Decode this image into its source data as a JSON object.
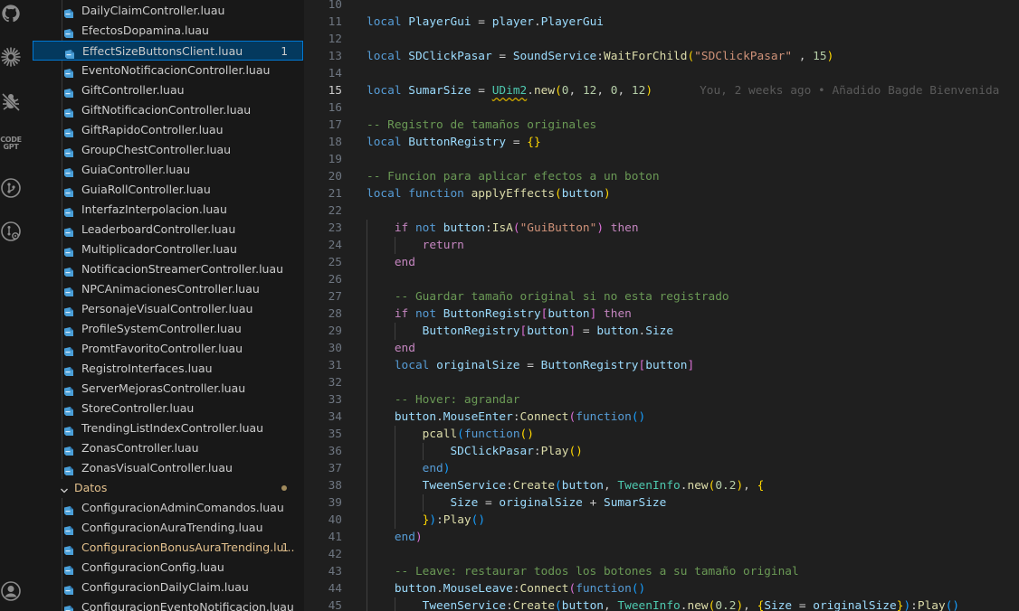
{
  "colors": {
    "modified": "#e2c08d",
    "selection": "#04395e",
    "focus_border": "#0078d4",
    "file_icon": "#4a9fd8"
  },
  "activity_bar": {
    "icons": [
      {
        "name": "github-icon"
      },
      {
        "name": "gear-flower-icon"
      },
      {
        "name": "no-bug-icon"
      },
      {
        "name": "codegpt-icon",
        "text": "CODE GPT"
      },
      {
        "name": "git-graph-icon"
      },
      {
        "name": "gitlens-icon"
      },
      {
        "name": "account-icon"
      }
    ]
  },
  "explorer": {
    "files_top": [
      {
        "label": "DailyClaimController.luau"
      },
      {
        "label": "EfectosDopamina.luau"
      },
      {
        "label": "EffectSizeButtonsClient.luau",
        "badge": "1",
        "selected": true
      },
      {
        "label": "EventoNotificacionController.luau"
      },
      {
        "label": "GiftController.luau"
      },
      {
        "label": "GiftNotificacionController.luau"
      },
      {
        "label": "GiftRapidoController.luau"
      },
      {
        "label": "GroupChestController.luau"
      },
      {
        "label": "GuiaController.luau"
      },
      {
        "label": "GuiaRollController.luau"
      },
      {
        "label": "InterfazInterpolacion.luau"
      },
      {
        "label": "LeaderboardController.luau"
      },
      {
        "label": "MultiplicadorController.luau"
      },
      {
        "label": "NotificacionStreamerController.luau"
      },
      {
        "label": "NPCAnimacionesController.luau"
      },
      {
        "label": "PersonajeVisualController.luau"
      },
      {
        "label": "ProfileSystemController.luau"
      },
      {
        "label": "PromtFavoritoController.luau"
      },
      {
        "label": "RegistroInterfaces.luau"
      },
      {
        "label": "ServerMejorasController.luau"
      },
      {
        "label": "StoreController.luau"
      },
      {
        "label": "TrendingListIndexController.luau"
      },
      {
        "label": "ZonasController.luau"
      },
      {
        "label": "ZonasVisualController.luau"
      }
    ],
    "folder": {
      "label": "Datos"
    },
    "files_bottom": [
      {
        "label": "ConfiguracionAdminComandos.luau"
      },
      {
        "label": "ConfiguracionAuraTrending.luau"
      },
      {
        "label": "ConfiguracionBonusAuraTrending.lu...",
        "badge": "1",
        "modified": true
      },
      {
        "label": "ConfiguracionConfig.luau"
      },
      {
        "label": "ConfiguracionDailyClaim.luau"
      },
      {
        "label": "ConfiguracionEventoNotificacion.luau"
      }
    ]
  },
  "editor": {
    "active_line": "15",
    "blame": "You, 2 weeks ago • Añadido Bagde Bienvenida",
    "lines": [
      {
        "n": "10",
        "tokens": []
      },
      {
        "n": "11",
        "tokens": [
          [
            "kw",
            "local "
          ],
          [
            "var",
            "PlayerGui"
          ],
          [
            "p",
            " = "
          ],
          [
            "var",
            "player"
          ],
          [
            "p",
            "."
          ],
          [
            "var",
            "PlayerGui"
          ]
        ]
      },
      {
        "n": "12",
        "tokens": []
      },
      {
        "n": "13",
        "tokens": [
          [
            "kw",
            "local "
          ],
          [
            "var",
            "SDClickPasar"
          ],
          [
            "p",
            " = "
          ],
          [
            "var",
            "SoundService"
          ],
          [
            "p",
            ":"
          ],
          [
            "fn",
            "WaitForChild"
          ],
          [
            "brk1",
            "("
          ],
          [
            "str",
            "\"SDClickPasar\""
          ],
          [
            "p",
            " , "
          ],
          [
            "num",
            "15"
          ],
          [
            "brk1",
            ")"
          ]
        ]
      },
      {
        "n": "14",
        "tokens": []
      },
      {
        "n": "15",
        "tokens": [
          [
            "kw",
            "local "
          ],
          [
            "var",
            "SumarSize"
          ],
          [
            "p",
            " = "
          ],
          [
            "sq",
            "UDim2"
          ],
          [
            "p",
            "."
          ],
          [
            "fn",
            "new"
          ],
          [
            "brk1",
            "("
          ],
          [
            "num",
            "0"
          ],
          [
            "p",
            ", "
          ],
          [
            "num",
            "12"
          ],
          [
            "p",
            ", "
          ],
          [
            "num",
            "0"
          ],
          [
            "p",
            ", "
          ],
          [
            "num",
            "12"
          ],
          [
            "brk1",
            ")"
          ]
        ],
        "blame": true
      },
      {
        "n": "16",
        "tokens": []
      },
      {
        "n": "17",
        "tokens": [
          [
            "cmt",
            "-- Registro de tamaños originales"
          ]
        ]
      },
      {
        "n": "18",
        "tokens": [
          [
            "kw",
            "local "
          ],
          [
            "var",
            "ButtonRegistry"
          ],
          [
            "p",
            " = "
          ],
          [
            "brk1",
            "{}"
          ]
        ]
      },
      {
        "n": "19",
        "tokens": []
      },
      {
        "n": "20",
        "tokens": [
          [
            "cmt",
            "-- Funcion para aplicar efectos a un boton"
          ]
        ]
      },
      {
        "n": "21",
        "tokens": [
          [
            "kw",
            "local function "
          ],
          [
            "fn",
            "applyEffects"
          ],
          [
            "brk1",
            "("
          ],
          [
            "var",
            "button"
          ],
          [
            "brk1",
            ")"
          ]
        ]
      },
      {
        "n": "22",
        "tokens": []
      },
      {
        "n": "23",
        "tokens": [
          [
            "p",
            "    "
          ],
          [
            "ctrl",
            "if "
          ],
          [
            "kw",
            "not "
          ],
          [
            "var",
            "button"
          ],
          [
            "p",
            ":"
          ],
          [
            "fn",
            "IsA"
          ],
          [
            "brk2",
            "("
          ],
          [
            "str",
            "\"GuiButton\""
          ],
          [
            "brk2",
            ")"
          ],
          [
            "ctrl",
            " then"
          ]
        ]
      },
      {
        "n": "24",
        "tokens": [
          [
            "p",
            "        "
          ],
          [
            "ctrl",
            "return"
          ]
        ]
      },
      {
        "n": "25",
        "tokens": [
          [
            "p",
            "    "
          ],
          [
            "ctrl",
            "end"
          ]
        ]
      },
      {
        "n": "26",
        "tokens": []
      },
      {
        "n": "27",
        "tokens": [
          [
            "p",
            "    "
          ],
          [
            "cmt",
            "-- Guardar tamaño original si no esta registrado"
          ]
        ]
      },
      {
        "n": "28",
        "tokens": [
          [
            "p",
            "    "
          ],
          [
            "ctrl",
            "if "
          ],
          [
            "kw",
            "not "
          ],
          [
            "var",
            "ButtonRegistry"
          ],
          [
            "brk2",
            "["
          ],
          [
            "var",
            "button"
          ],
          [
            "brk2",
            "]"
          ],
          [
            "ctrl",
            " then"
          ]
        ]
      },
      {
        "n": "29",
        "tokens": [
          [
            "p",
            "        "
          ],
          [
            "var",
            "ButtonRegistry"
          ],
          [
            "brk2",
            "["
          ],
          [
            "var",
            "button"
          ],
          [
            "brk2",
            "]"
          ],
          [
            "p",
            " = "
          ],
          [
            "var",
            "button"
          ],
          [
            "p",
            "."
          ],
          [
            "var",
            "Size"
          ]
        ]
      },
      {
        "n": "30",
        "tokens": [
          [
            "p",
            "    "
          ],
          [
            "ctrl",
            "end"
          ]
        ]
      },
      {
        "n": "31",
        "tokens": [
          [
            "p",
            "    "
          ],
          [
            "kw",
            "local "
          ],
          [
            "var",
            "originalSize"
          ],
          [
            "p",
            " = "
          ],
          [
            "var",
            "ButtonRegistry"
          ],
          [
            "brk2",
            "["
          ],
          [
            "var",
            "button"
          ],
          [
            "brk2",
            "]"
          ]
        ]
      },
      {
        "n": "32",
        "tokens": []
      },
      {
        "n": "33",
        "tokens": [
          [
            "p",
            "    "
          ],
          [
            "cmt",
            "-- Hover: agrandar"
          ]
        ]
      },
      {
        "n": "34",
        "tokens": [
          [
            "p",
            "    "
          ],
          [
            "var",
            "button"
          ],
          [
            "p",
            "."
          ],
          [
            "var",
            "MouseEnter"
          ],
          [
            "p",
            ":"
          ],
          [
            "fn",
            "Connect"
          ],
          [
            "brk2",
            "("
          ],
          [
            "kw",
            "function"
          ],
          [
            "brk3",
            "()"
          ]
        ]
      },
      {
        "n": "35",
        "tokens": [
          [
            "p",
            "        "
          ],
          [
            "fn",
            "pcall"
          ],
          [
            "brk3",
            "("
          ],
          [
            "kw",
            "function"
          ],
          [
            "brk1",
            "()"
          ]
        ]
      },
      {
        "n": "36",
        "tokens": [
          [
            "p",
            "            "
          ],
          [
            "var",
            "SDClickPasar"
          ],
          [
            "p",
            ":"
          ],
          [
            "fn",
            "Play"
          ],
          [
            "brk1",
            "()"
          ]
        ]
      },
      {
        "n": "37",
        "tokens": [
          [
            "p",
            "        "
          ],
          [
            "kw",
            "end"
          ],
          [
            "brk3",
            ")"
          ]
        ]
      },
      {
        "n": "38",
        "tokens": [
          [
            "p",
            "        "
          ],
          [
            "var",
            "TweenService"
          ],
          [
            "p",
            ":"
          ],
          [
            "fn",
            "Create"
          ],
          [
            "brk3",
            "("
          ],
          [
            "var",
            "button"
          ],
          [
            "p",
            ", "
          ],
          [
            "cls",
            "TweenInfo"
          ],
          [
            "p",
            "."
          ],
          [
            "fn",
            "new"
          ],
          [
            "brk1",
            "("
          ],
          [
            "num",
            "0.2"
          ],
          [
            "brk1",
            ")"
          ],
          [
            "p",
            ", "
          ],
          [
            "brk1",
            "{"
          ]
        ]
      },
      {
        "n": "39",
        "tokens": [
          [
            "p",
            "            "
          ],
          [
            "var",
            "Size"
          ],
          [
            "p",
            " = "
          ],
          [
            "var",
            "originalSize"
          ],
          [
            "p",
            " + "
          ],
          [
            "var",
            "SumarSize"
          ]
        ]
      },
      {
        "n": "40",
        "tokens": [
          [
            "p",
            "        "
          ],
          [
            "brk1",
            "}"
          ],
          [
            "brk3",
            ")"
          ],
          [
            "p",
            ":"
          ],
          [
            "fn",
            "Play"
          ],
          [
            "brk3",
            "()"
          ]
        ]
      },
      {
        "n": "41",
        "tokens": [
          [
            "p",
            "    "
          ],
          [
            "kw",
            "end"
          ],
          [
            "brk2",
            ")"
          ]
        ]
      },
      {
        "n": "42",
        "tokens": []
      },
      {
        "n": "43",
        "tokens": [
          [
            "p",
            "    "
          ],
          [
            "cmt",
            "-- Leave: restaurar todos los botones a su tamaño original"
          ]
        ]
      },
      {
        "n": "44",
        "tokens": [
          [
            "p",
            "    "
          ],
          [
            "var",
            "button"
          ],
          [
            "p",
            "."
          ],
          [
            "var",
            "MouseLeave"
          ],
          [
            "p",
            ":"
          ],
          [
            "fn",
            "Connect"
          ],
          [
            "brk2",
            "("
          ],
          [
            "kw",
            "function"
          ],
          [
            "brk3",
            "()"
          ]
        ]
      },
      {
        "n": "45",
        "tokens": [
          [
            "p",
            "        "
          ],
          [
            "var",
            "TweenService"
          ],
          [
            "p",
            ":"
          ],
          [
            "fn",
            "Create"
          ],
          [
            "brk3",
            "("
          ],
          [
            "var",
            "button"
          ],
          [
            "p",
            ", "
          ],
          [
            "cls",
            "TweenInfo"
          ],
          [
            "p",
            "."
          ],
          [
            "fn",
            "new"
          ],
          [
            "brk1",
            "("
          ],
          [
            "num",
            "0.2"
          ],
          [
            "brk1",
            ")"
          ],
          [
            "p",
            ", "
          ],
          [
            "brk1",
            "{"
          ],
          [
            "var",
            "Size"
          ],
          [
            "p",
            " = "
          ],
          [
            "var",
            "originalSize"
          ],
          [
            "brk1",
            "}"
          ],
          [
            "brk3",
            ")"
          ],
          [
            "p",
            ":"
          ],
          [
            "fn",
            "Play"
          ],
          [
            "brk3",
            "()"
          ]
        ]
      }
    ]
  }
}
